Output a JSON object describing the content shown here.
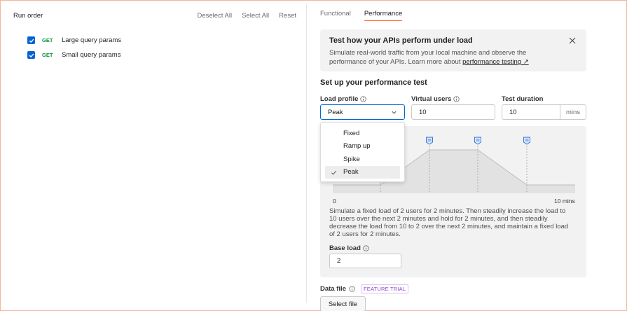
{
  "run_order": {
    "title": "Run order",
    "actions": {
      "deselect_all": "Deselect All",
      "select_all": "Select All",
      "reset": "Reset"
    },
    "requests": [
      {
        "method": "GET",
        "name": "Large query params",
        "checked": true
      },
      {
        "method": "GET",
        "name": "Small query params",
        "checked": true
      }
    ]
  },
  "tabs": [
    {
      "label": "Functional",
      "active": false
    },
    {
      "label": "Performance",
      "active": true
    }
  ],
  "banner": {
    "title": "Test how your APIs perform under load",
    "text": "Simulate real-world traffic from your local machine and observe the performance of your APIs. Learn more about",
    "link": "performance testing ↗"
  },
  "setup": {
    "title": "Set up your performance test",
    "load_profile": {
      "label": "Load profile",
      "value": "Peak"
    },
    "virtual_users": {
      "label": "Virtual users",
      "value": "10"
    },
    "test_duration": {
      "label": "Test duration",
      "value": "10",
      "unit": "mins"
    },
    "dropdown_options": [
      "Fixed",
      "Ramp up",
      "Spike",
      "Peak"
    ],
    "selected_option": "Peak",
    "graph": {
      "x_start": "0",
      "x_end": "10 mins"
    },
    "description": "Simulate a fixed load of 2 users for 2 minutes. Then steadily increase the load to 10 users over the next 2 minutes and hold for 2 minutes, and then steadily decrease the load from 10 to 2 over the next 2 minutes, and maintain a fixed load of 2 users for 2 minutes.",
    "base_load": {
      "label": "Base load",
      "value": "2"
    },
    "data_file": {
      "label": "Data file",
      "badge": "FEATURE TRIAL",
      "button": "Select file"
    }
  },
  "colors": {
    "accent": "#0265d2",
    "tab_underline": "#ff6c37",
    "method_get": "#0a8f3c",
    "badge": "#8a46c9"
  }
}
